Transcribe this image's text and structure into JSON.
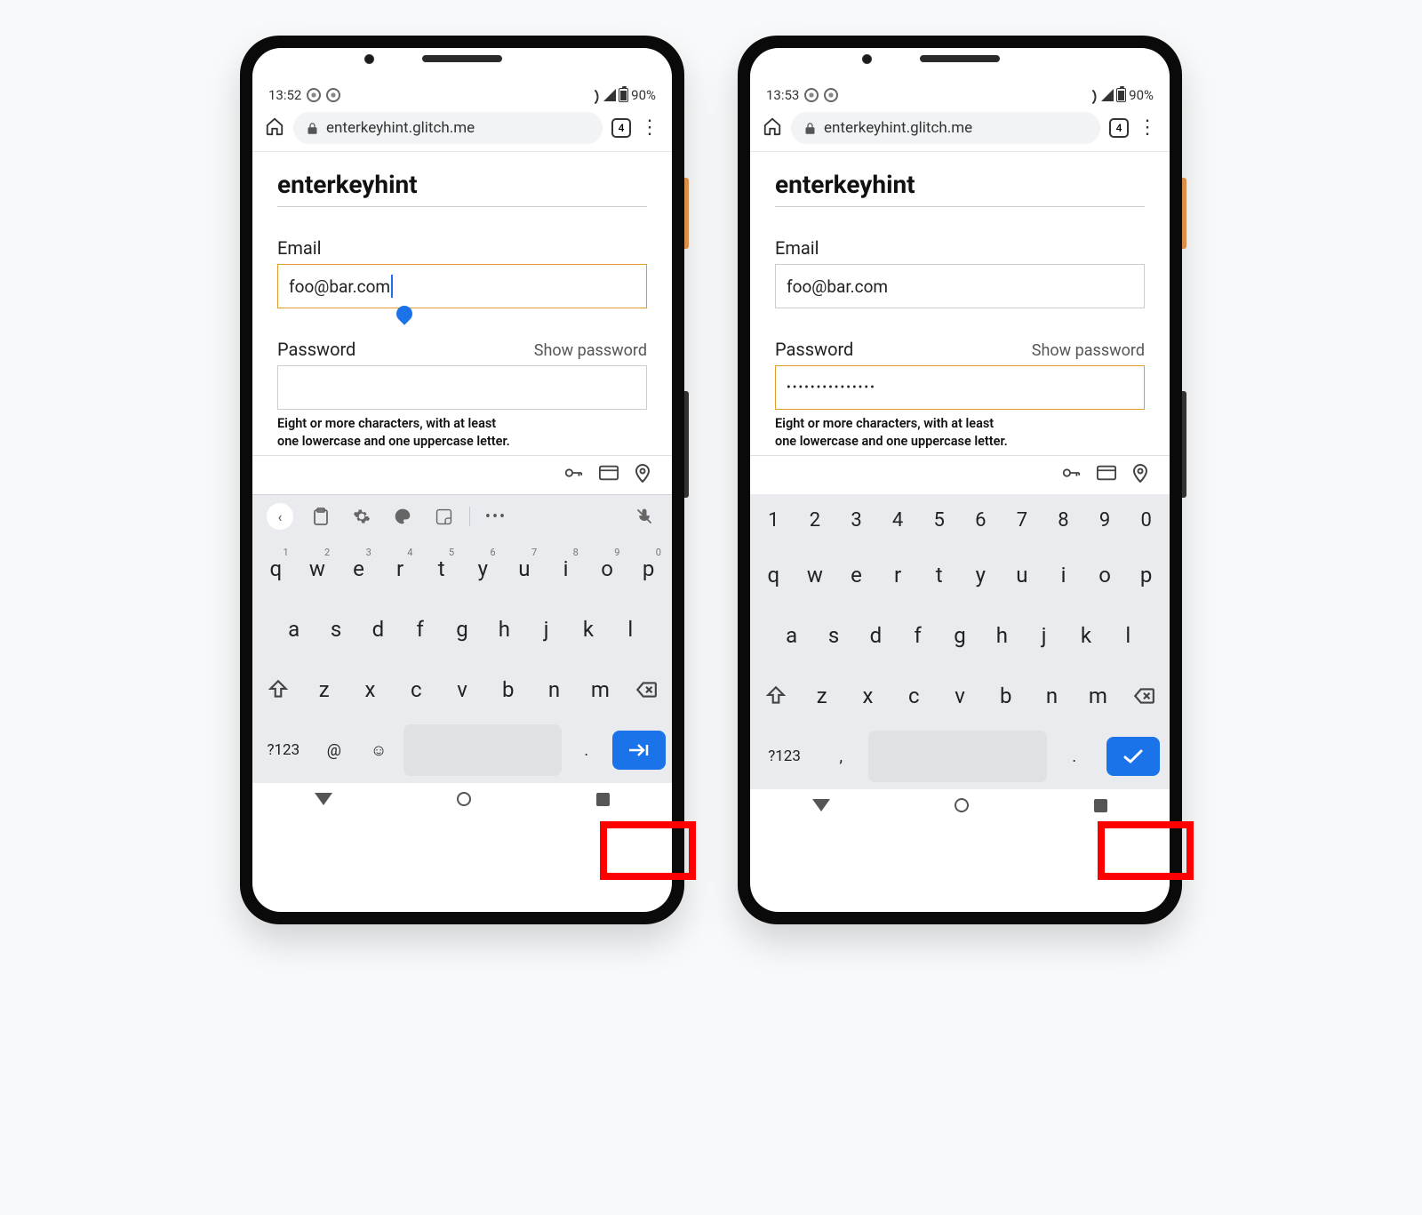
{
  "phones": [
    {
      "status": {
        "time": "13:52",
        "battery": "90%"
      },
      "browser": {
        "url": "enterkeyhint.glitch.me",
        "tab_count": "4"
      },
      "page": {
        "title": "enterkeyhint",
        "email_label": "Email",
        "email_value": "foo@bar.com",
        "email_focused": true,
        "password_label": "Password",
        "show_password": "Show password",
        "password_value": "",
        "password_focused": false,
        "helper_line1": "Eight or more characters, with at least",
        "helper_line2": "one lowercase and one uppercase letter."
      },
      "keyboard": {
        "show_number_row": false,
        "show_toolbar": true,
        "row1": [
          {
            "k": "q",
            "s": "1"
          },
          {
            "k": "w",
            "s": "2"
          },
          {
            "k": "e",
            "s": "3"
          },
          {
            "k": "r",
            "s": "4"
          },
          {
            "k": "t",
            "s": "5"
          },
          {
            "k": "y",
            "s": "6"
          },
          {
            "k": "u",
            "s": "7"
          },
          {
            "k": "i",
            "s": "8"
          },
          {
            "k": "o",
            "s": "9"
          },
          {
            "k": "p",
            "s": "0"
          }
        ],
        "row2": [
          "a",
          "s",
          "d",
          "f",
          "g",
          "h",
          "j",
          "k",
          "l"
        ],
        "row3": [
          "z",
          "x",
          "c",
          "v",
          "b",
          "n",
          "m"
        ],
        "bottom": {
          "sym": "?123",
          "left1": "@",
          "left2_emoji": true,
          "dot": ".",
          "comma_instead_of_at": false
        },
        "enter_icon": "next"
      }
    },
    {
      "status": {
        "time": "13:53",
        "battery": "90%"
      },
      "browser": {
        "url": "enterkeyhint.glitch.me",
        "tab_count": "4"
      },
      "page": {
        "title": "enterkeyhint",
        "email_label": "Email",
        "email_value": "foo@bar.com",
        "email_focused": false,
        "password_label": "Password",
        "show_password": "Show password",
        "password_value": "•••••••••••••••",
        "password_focused": true,
        "helper_line1": "Eight or more characters, with at least",
        "helper_line2": "one lowercase and one uppercase letter."
      },
      "keyboard": {
        "show_number_row": true,
        "show_toolbar": false,
        "numrow": [
          "1",
          "2",
          "3",
          "4",
          "5",
          "6",
          "7",
          "8",
          "9",
          "0"
        ],
        "row1": [
          {
            "k": "q"
          },
          {
            "k": "w"
          },
          {
            "k": "e"
          },
          {
            "k": "r"
          },
          {
            "k": "t"
          },
          {
            "k": "y"
          },
          {
            "k": "u"
          },
          {
            "k": "i"
          },
          {
            "k": "o"
          },
          {
            "k": "p"
          }
        ],
        "row2": [
          "a",
          "s",
          "d",
          "f",
          "g",
          "h",
          "j",
          "k",
          "l"
        ],
        "row3": [
          "z",
          "x",
          "c",
          "v",
          "b",
          "n",
          "m"
        ],
        "bottom": {
          "sym": "?123",
          "left1": ",",
          "left2_emoji": false,
          "dot": ".",
          "comma_instead_of_at": true
        },
        "enter_icon": "done"
      }
    }
  ]
}
